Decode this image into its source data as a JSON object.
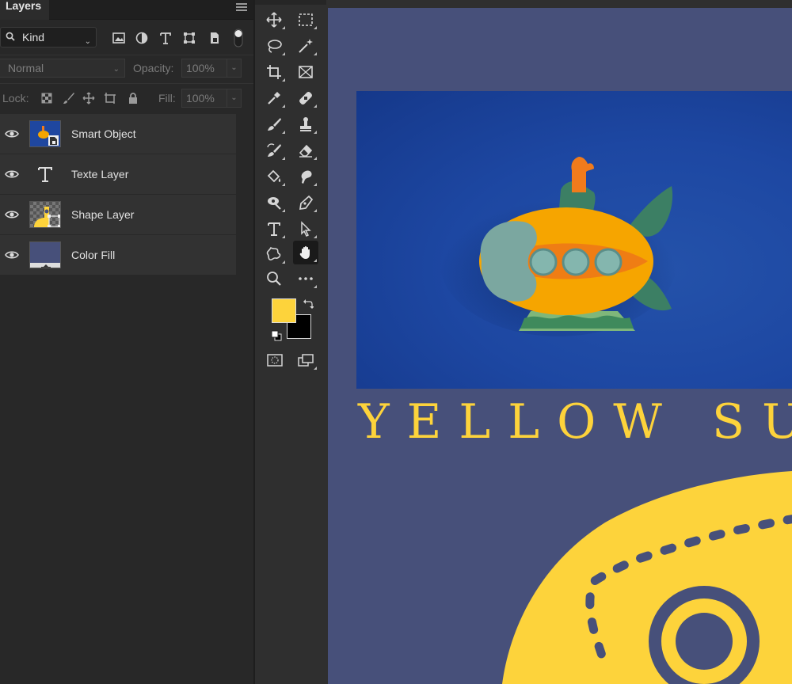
{
  "panel": {
    "tab_label": "Layers",
    "filter_kind": "Kind",
    "blend_mode": "Normal",
    "opacity_label": "Opacity:",
    "opacity_value": "100%",
    "lock_label": "Lock:",
    "fill_label": "Fill:",
    "fill_value": "100%",
    "filter_icons": [
      "image-filter-icon",
      "adjustment-filter-icon",
      "type-filter-icon",
      "shape-filter-icon",
      "smart-object-filter-icon"
    ],
    "lock_icons": [
      "lock-transparent-icon",
      "lock-image-icon",
      "lock-position-icon",
      "lock-artboard-icon",
      "lock-all-icon"
    ]
  },
  "layers": [
    {
      "name": "Smart Object",
      "type": "smart-object",
      "visible": true
    },
    {
      "name": "Texte Layer",
      "type": "text",
      "visible": true
    },
    {
      "name": "Shape Layer",
      "type": "shape",
      "visible": true
    },
    {
      "name": "Color Fill",
      "type": "fill",
      "visible": true
    }
  ],
  "toolbar": {
    "tools": [
      "move-tool",
      "marquee-tool",
      "lasso-tool",
      "magic-wand-tool",
      "crop-tool",
      "frame-tool",
      "eyedropper-tool",
      "healing-brush-tool",
      "brush-tool",
      "clone-stamp-tool",
      "history-brush-tool",
      "eraser-tool",
      "paint-bucket-tool",
      "smudge-tool",
      "dodge-tool",
      "pen-tool",
      "type-tool",
      "path-selection-tool",
      "custom-shape-tool",
      "hand-tool",
      "zoom-tool",
      "more-tools"
    ],
    "active_tool": "hand-tool",
    "foreground_color": "#fdd33b",
    "background_color": "#000000"
  },
  "canvas": {
    "title_text": "YELLOW SUB",
    "background_color": "#47507a",
    "accent_color": "#fdd33b"
  }
}
